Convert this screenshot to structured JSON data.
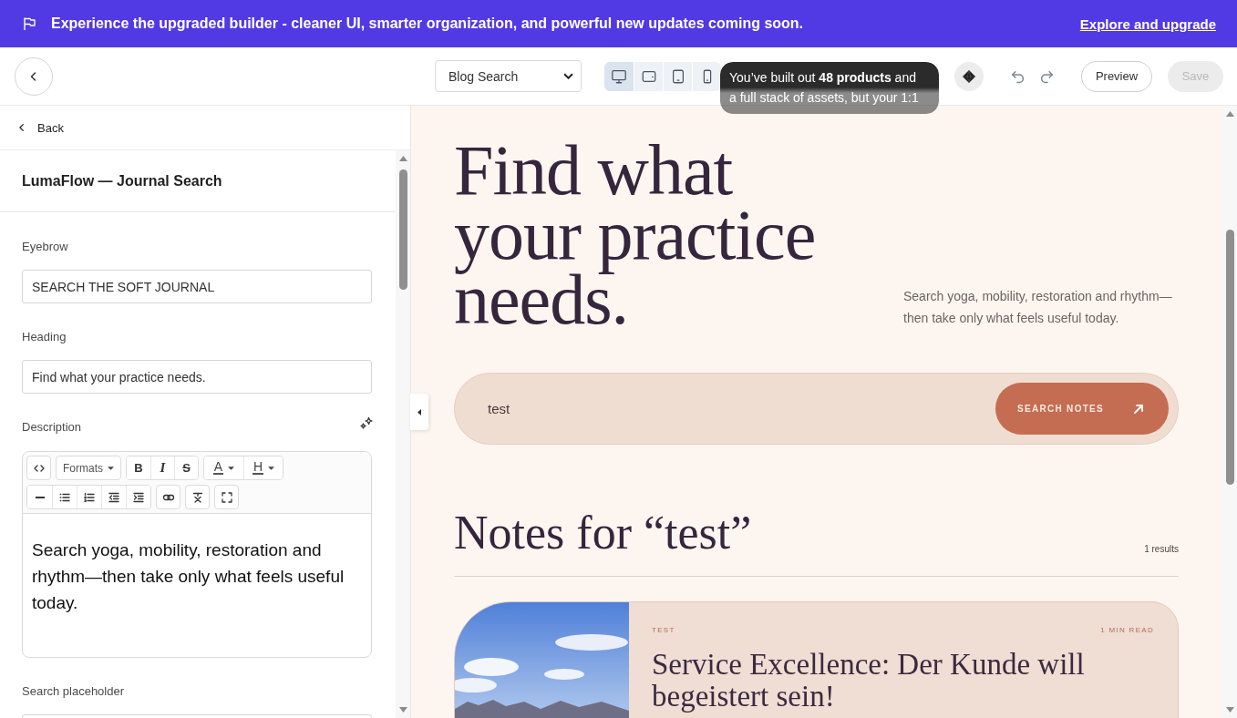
{
  "banner": {
    "message": "Experience the upgraded builder - cleaner UI, smarter organization, and powerful new updates coming soon.",
    "link": "Explore and upgrade"
  },
  "toolbar": {
    "page_select": "Blog Search",
    "devices": [
      {
        "kind": "desktop",
        "selected": true
      },
      {
        "kind": "tablet_landscape",
        "selected": false
      },
      {
        "kind": "tablet",
        "selected": false
      },
      {
        "kind": "mobile",
        "selected": false
      }
    ],
    "tooltip": "You’ve built out **48 products** and a full stack of assets, but your 1:1",
    "preview": "Preview",
    "save": {
      "label": "Save",
      "disabled": true
    }
  },
  "sidebar": {
    "back": "Back",
    "title": "LumaFlow — Journal Search",
    "fields": [
      {
        "kind": "text",
        "label": "Eyebrow",
        "value": "SEARCH THE SOFT JOURNAL"
      },
      {
        "kind": "text",
        "label": "Heading",
        "value": "Find what your practice needs."
      },
      {
        "kind": "rich",
        "label": "Description",
        "toolbar": {
          "formats": "Formats",
          "bold": "B",
          "italic": "I",
          "strikethrough": "S",
          "text_color": "A",
          "highlight": "H"
        },
        "text": "Search yoga, mobility, restoration and rhythm—then take only what feels useful today."
      },
      {
        "kind": "text",
        "label": "Search placeholder"
      }
    ]
  },
  "preview": {
    "heading": "Find what your practice needs.",
    "description": "Search yoga, mobility, restoration and rhythm—then take only what feels useful today.",
    "search": {
      "value": "test",
      "button": "SEARCH NOTES"
    },
    "results": {
      "title": "Notes for “test”",
      "count": "1 results"
    },
    "cards": [
      {
        "tag": "TEST",
        "read_time": "1 MIN READ",
        "title": "Service Excellence: Der Kunde will begeistert sein!"
      }
    ]
  }
}
